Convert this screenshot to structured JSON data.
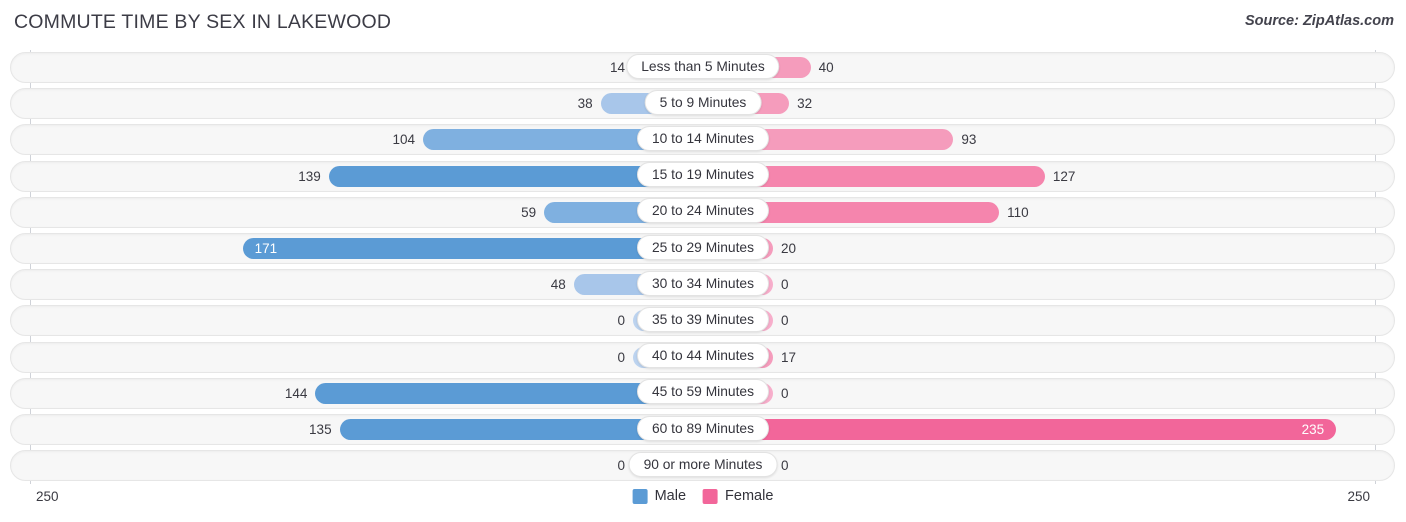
{
  "header": {
    "title": "COMMUTE TIME BY SEX IN LAKEWOOD",
    "source": "Source: ZipAtlas.com"
  },
  "axis": {
    "left_label": "250",
    "right_label": "250",
    "max": 250
  },
  "legend": {
    "items": [
      {
        "label": "Male",
        "color": "#5b9bd5"
      },
      {
        "label": "Female",
        "color": "#f2669a"
      }
    ]
  },
  "colors": {
    "male_strong": "#5b9bd5",
    "male_mid": "#7fb0e0",
    "male_light": "#a8c6ea",
    "male_pale": "#bcd3ef",
    "female_strong": "#f2669a",
    "female_mid": "#f585ad",
    "female_light": "#f59cbc",
    "female_pale": "#f7aecb",
    "track": "#f7f7f7",
    "pill": "#ffffff"
  },
  "chart_data": {
    "type": "bar",
    "orientation": "horizontal-diverging",
    "title": "COMMUTE TIME BY SEX IN LAKEWOOD",
    "xlabel": "",
    "ylabel": "",
    "xlim": [
      250,
      250
    ],
    "grid": false,
    "legend_position": "bottom-center",
    "categories": [
      "Less than 5 Minutes",
      "5 to 9 Minutes",
      "10 to 14 Minutes",
      "15 to 19 Minutes",
      "20 to 24 Minutes",
      "25 to 29 Minutes",
      "30 to 34 Minutes",
      "35 to 39 Minutes",
      "40 to 44 Minutes",
      "45 to 59 Minutes",
      "60 to 89 Minutes",
      "90 or more Minutes"
    ],
    "series": [
      {
        "name": "Male",
        "values": [
          14,
          38,
          104,
          139,
          59,
          171,
          48,
          0,
          0,
          144,
          135,
          0
        ]
      },
      {
        "name": "Female",
        "values": [
          40,
          32,
          93,
          127,
          110,
          20,
          0,
          0,
          17,
          0,
          235,
          0
        ]
      }
    ]
  },
  "rows": [
    {
      "label": "Less than 5 Minutes",
      "male": 14,
      "female": 40,
      "male_text": "14",
      "female_text": "40"
    },
    {
      "label": "5 to 9 Minutes",
      "male": 38,
      "female": 32,
      "male_text": "38",
      "female_text": "32"
    },
    {
      "label": "10 to 14 Minutes",
      "male": 104,
      "female": 93,
      "male_text": "104",
      "female_text": "93"
    },
    {
      "label": "15 to 19 Minutes",
      "male": 139,
      "female": 127,
      "male_text": "139",
      "female_text": "127"
    },
    {
      "label": "20 to 24 Minutes",
      "male": 59,
      "female": 110,
      "male_text": "59",
      "female_text": "110"
    },
    {
      "label": "25 to 29 Minutes",
      "male": 171,
      "female": 20,
      "male_text": "171",
      "female_text": "20"
    },
    {
      "label": "30 to 34 Minutes",
      "male": 48,
      "female": 0,
      "male_text": "48",
      "female_text": "0"
    },
    {
      "label": "35 to 39 Minutes",
      "male": 0,
      "female": 0,
      "male_text": "0",
      "female_text": "0"
    },
    {
      "label": "40 to 44 Minutes",
      "male": 0,
      "female": 17,
      "male_text": "0",
      "female_text": "17"
    },
    {
      "label": "45 to 59 Minutes",
      "male": 144,
      "female": 0,
      "male_text": "144",
      "female_text": "0"
    },
    {
      "label": "60 to 89 Minutes",
      "male": 135,
      "female": 235,
      "male_text": "135",
      "female_text": "235"
    },
    {
      "label": "90 or more Minutes",
      "male": 0,
      "female": 0,
      "male_text": "0",
      "female_text": "0"
    }
  ]
}
